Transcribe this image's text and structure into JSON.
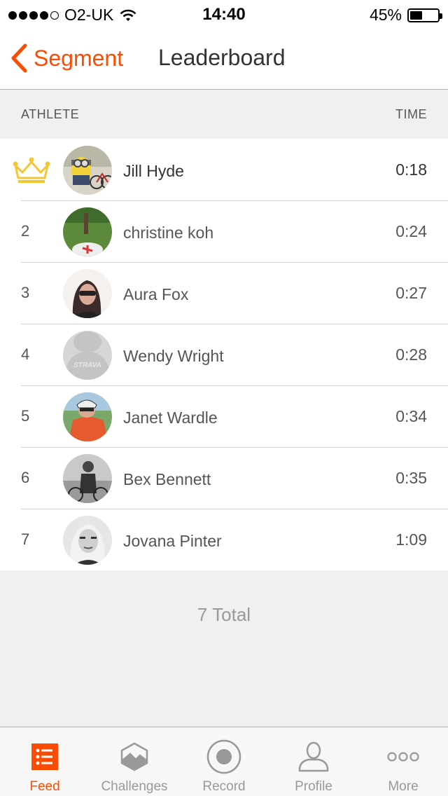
{
  "status_bar": {
    "carrier": "O2-UK",
    "time": "14:40",
    "battery": "45%",
    "battery_level": 0.45,
    "signal_bars_filled": 4,
    "signal_bars_total": 5
  },
  "nav": {
    "back_label": "Segment",
    "title": "Leaderboard"
  },
  "columns": {
    "athlete": "ATHLETE",
    "time": "TIME"
  },
  "leaderboard": [
    {
      "rank": "1",
      "name": "Jill Hyde",
      "time": "0:18",
      "avatar": "minion-bike-avatar"
    },
    {
      "rank": "2",
      "name": "christine koh",
      "time": "0:24",
      "avatar": "grass-avatar"
    },
    {
      "rank": "3",
      "name": "Aura Fox",
      "time": "0:27",
      "avatar": "sunglasses-avatar"
    },
    {
      "rank": "4",
      "name": "Wendy Wright",
      "time": "0:28",
      "avatar": "strava-default-avatar"
    },
    {
      "rank": "5",
      "name": "Janet Wardle",
      "time": "0:34",
      "avatar": "cyclist-helmet-avatar"
    },
    {
      "rank": "6",
      "name": "Bex Bennett",
      "time": "0:35",
      "avatar": "cyclist-bw-avatar"
    },
    {
      "rank": "7",
      "name": "Jovana Pinter",
      "time": "1:09",
      "avatar": "portrait-bw-avatar"
    }
  ],
  "default_avatar_text": "STRAVA",
  "total": "7 Total",
  "tabs": [
    {
      "label": "Feed",
      "icon": "feed-icon",
      "active": true
    },
    {
      "label": "Challenges",
      "icon": "challenges-icon",
      "active": false
    },
    {
      "label": "Record",
      "icon": "record-icon",
      "active": false
    },
    {
      "label": "Profile",
      "icon": "profile-icon",
      "active": false
    },
    {
      "label": "More",
      "icon": "more-icon",
      "active": false
    }
  ],
  "colors": {
    "accent": "#fc4c02",
    "crown": "#f5c533",
    "tab_inactive": "#999999"
  }
}
